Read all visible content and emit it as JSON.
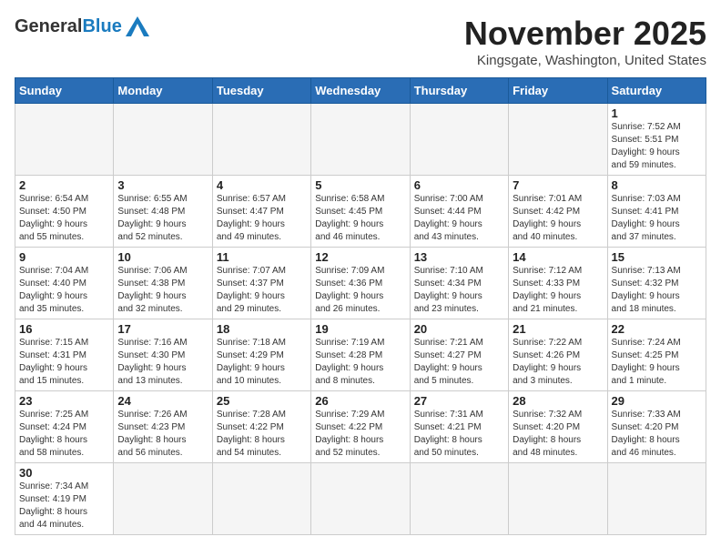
{
  "header": {
    "logo_general": "General",
    "logo_blue": "Blue",
    "month_title": "November 2025",
    "location": "Kingsgate, Washington, United States"
  },
  "weekdays": [
    "Sunday",
    "Monday",
    "Tuesday",
    "Wednesday",
    "Thursday",
    "Friday",
    "Saturday"
  ],
  "days": [
    {
      "num": "",
      "info": "",
      "empty": true
    },
    {
      "num": "",
      "info": "",
      "empty": true
    },
    {
      "num": "",
      "info": "",
      "empty": true
    },
    {
      "num": "",
      "info": "",
      "empty": true
    },
    {
      "num": "",
      "info": "",
      "empty": true
    },
    {
      "num": "",
      "info": "",
      "empty": true
    },
    {
      "num": "1",
      "info": "Sunrise: 7:52 AM\nSunset: 5:51 PM\nDaylight: 9 hours\nand 59 minutes."
    },
    {
      "num": "2",
      "info": "Sunrise: 6:54 AM\nSunset: 4:50 PM\nDaylight: 9 hours\nand 55 minutes."
    },
    {
      "num": "3",
      "info": "Sunrise: 6:55 AM\nSunset: 4:48 PM\nDaylight: 9 hours\nand 52 minutes."
    },
    {
      "num": "4",
      "info": "Sunrise: 6:57 AM\nSunset: 4:47 PM\nDaylight: 9 hours\nand 49 minutes."
    },
    {
      "num": "5",
      "info": "Sunrise: 6:58 AM\nSunset: 4:45 PM\nDaylight: 9 hours\nand 46 minutes."
    },
    {
      "num": "6",
      "info": "Sunrise: 7:00 AM\nSunset: 4:44 PM\nDaylight: 9 hours\nand 43 minutes."
    },
    {
      "num": "7",
      "info": "Sunrise: 7:01 AM\nSunset: 4:42 PM\nDaylight: 9 hours\nand 40 minutes."
    },
    {
      "num": "8",
      "info": "Sunrise: 7:03 AM\nSunset: 4:41 PM\nDaylight: 9 hours\nand 37 minutes."
    },
    {
      "num": "9",
      "info": "Sunrise: 7:04 AM\nSunset: 4:40 PM\nDaylight: 9 hours\nand 35 minutes."
    },
    {
      "num": "10",
      "info": "Sunrise: 7:06 AM\nSunset: 4:38 PM\nDaylight: 9 hours\nand 32 minutes."
    },
    {
      "num": "11",
      "info": "Sunrise: 7:07 AM\nSunset: 4:37 PM\nDaylight: 9 hours\nand 29 minutes."
    },
    {
      "num": "12",
      "info": "Sunrise: 7:09 AM\nSunset: 4:36 PM\nDaylight: 9 hours\nand 26 minutes."
    },
    {
      "num": "13",
      "info": "Sunrise: 7:10 AM\nSunset: 4:34 PM\nDaylight: 9 hours\nand 23 minutes."
    },
    {
      "num": "14",
      "info": "Sunrise: 7:12 AM\nSunset: 4:33 PM\nDaylight: 9 hours\nand 21 minutes."
    },
    {
      "num": "15",
      "info": "Sunrise: 7:13 AM\nSunset: 4:32 PM\nDaylight: 9 hours\nand 18 minutes."
    },
    {
      "num": "16",
      "info": "Sunrise: 7:15 AM\nSunset: 4:31 PM\nDaylight: 9 hours\nand 15 minutes."
    },
    {
      "num": "17",
      "info": "Sunrise: 7:16 AM\nSunset: 4:30 PM\nDaylight: 9 hours\nand 13 minutes."
    },
    {
      "num": "18",
      "info": "Sunrise: 7:18 AM\nSunset: 4:29 PM\nDaylight: 9 hours\nand 10 minutes."
    },
    {
      "num": "19",
      "info": "Sunrise: 7:19 AM\nSunset: 4:28 PM\nDaylight: 9 hours\nand 8 minutes."
    },
    {
      "num": "20",
      "info": "Sunrise: 7:21 AM\nSunset: 4:27 PM\nDaylight: 9 hours\nand 5 minutes."
    },
    {
      "num": "21",
      "info": "Sunrise: 7:22 AM\nSunset: 4:26 PM\nDaylight: 9 hours\nand 3 minutes."
    },
    {
      "num": "22",
      "info": "Sunrise: 7:24 AM\nSunset: 4:25 PM\nDaylight: 9 hours\nand 1 minute."
    },
    {
      "num": "23",
      "info": "Sunrise: 7:25 AM\nSunset: 4:24 PM\nDaylight: 8 hours\nand 58 minutes."
    },
    {
      "num": "24",
      "info": "Sunrise: 7:26 AM\nSunset: 4:23 PM\nDaylight: 8 hours\nand 56 minutes."
    },
    {
      "num": "25",
      "info": "Sunrise: 7:28 AM\nSunset: 4:22 PM\nDaylight: 8 hours\nand 54 minutes."
    },
    {
      "num": "26",
      "info": "Sunrise: 7:29 AM\nSunset: 4:22 PM\nDaylight: 8 hours\nand 52 minutes."
    },
    {
      "num": "27",
      "info": "Sunrise: 7:31 AM\nSunset: 4:21 PM\nDaylight: 8 hours\nand 50 minutes."
    },
    {
      "num": "28",
      "info": "Sunrise: 7:32 AM\nSunset: 4:20 PM\nDaylight: 8 hours\nand 48 minutes."
    },
    {
      "num": "29",
      "info": "Sunrise: 7:33 AM\nSunset: 4:20 PM\nDaylight: 8 hours\nand 46 minutes."
    },
    {
      "num": "30",
      "info": "Sunrise: 7:34 AM\nSunset: 4:19 PM\nDaylight: 8 hours\nand 44 minutes."
    },
    {
      "num": "",
      "info": "",
      "empty": true
    },
    {
      "num": "",
      "info": "",
      "empty": true
    },
    {
      "num": "",
      "info": "",
      "empty": true
    },
    {
      "num": "",
      "info": "",
      "empty": true
    },
    {
      "num": "",
      "info": "",
      "empty": true
    },
    {
      "num": "",
      "info": "",
      "empty": true
    }
  ]
}
